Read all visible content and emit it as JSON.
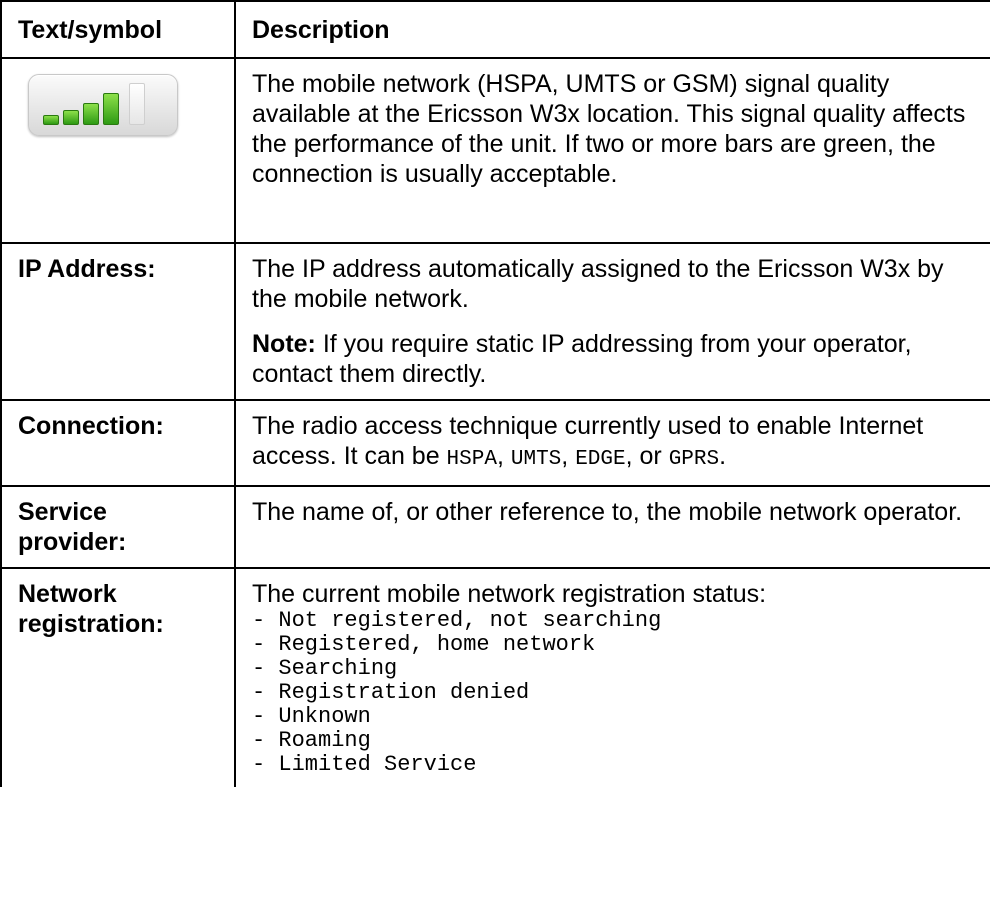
{
  "table": {
    "headers": {
      "col1": "Text/symbol",
      "col2": "Description"
    },
    "signal_row": {
      "icon": "signal-strength-icon",
      "bars_active": 4,
      "bars_total": 5,
      "active_color": "#3aa51a",
      "description": "The mobile network (HSPA, UMTS or GSM) signal quality available at the Ericsson W3x location. This signal quality affects the performance of the unit. If two or more bars are green, the connection is usually acceptable."
    },
    "ip_row": {
      "label": "IP Address:",
      "description": "The IP address automatically assigned to the Ericsson W3x by the mobile network.",
      "note_label": "Note:",
      "note_text": " If you require static IP addressing from your operator, contact them directly."
    },
    "connection_row": {
      "label": "Connection:",
      "description_prefix": "The radio access technique currently used to enable Internet access. It can be ",
      "techniques": [
        "HSPA",
        "UMTS",
        "EDGE",
        "GPRS"
      ],
      "sep1": ", ",
      "sep2": ", ",
      "sep3": ",  or ",
      "end": "."
    },
    "provider_row": {
      "label_line1": "Service",
      "label_line2": "provider:",
      "description": "The name of, or other reference to, the mobile network operator."
    },
    "registration_row": {
      "label_line1": "Network",
      "label_line2": "registration:",
      "description": "The current mobile network registration status:",
      "statuses": [
        "- Not registered, not searching",
        "- Registered, home network",
        "- Searching",
        "- Registration denied",
        "- Unknown",
        "- Roaming",
        "- Limited Service"
      ]
    }
  }
}
